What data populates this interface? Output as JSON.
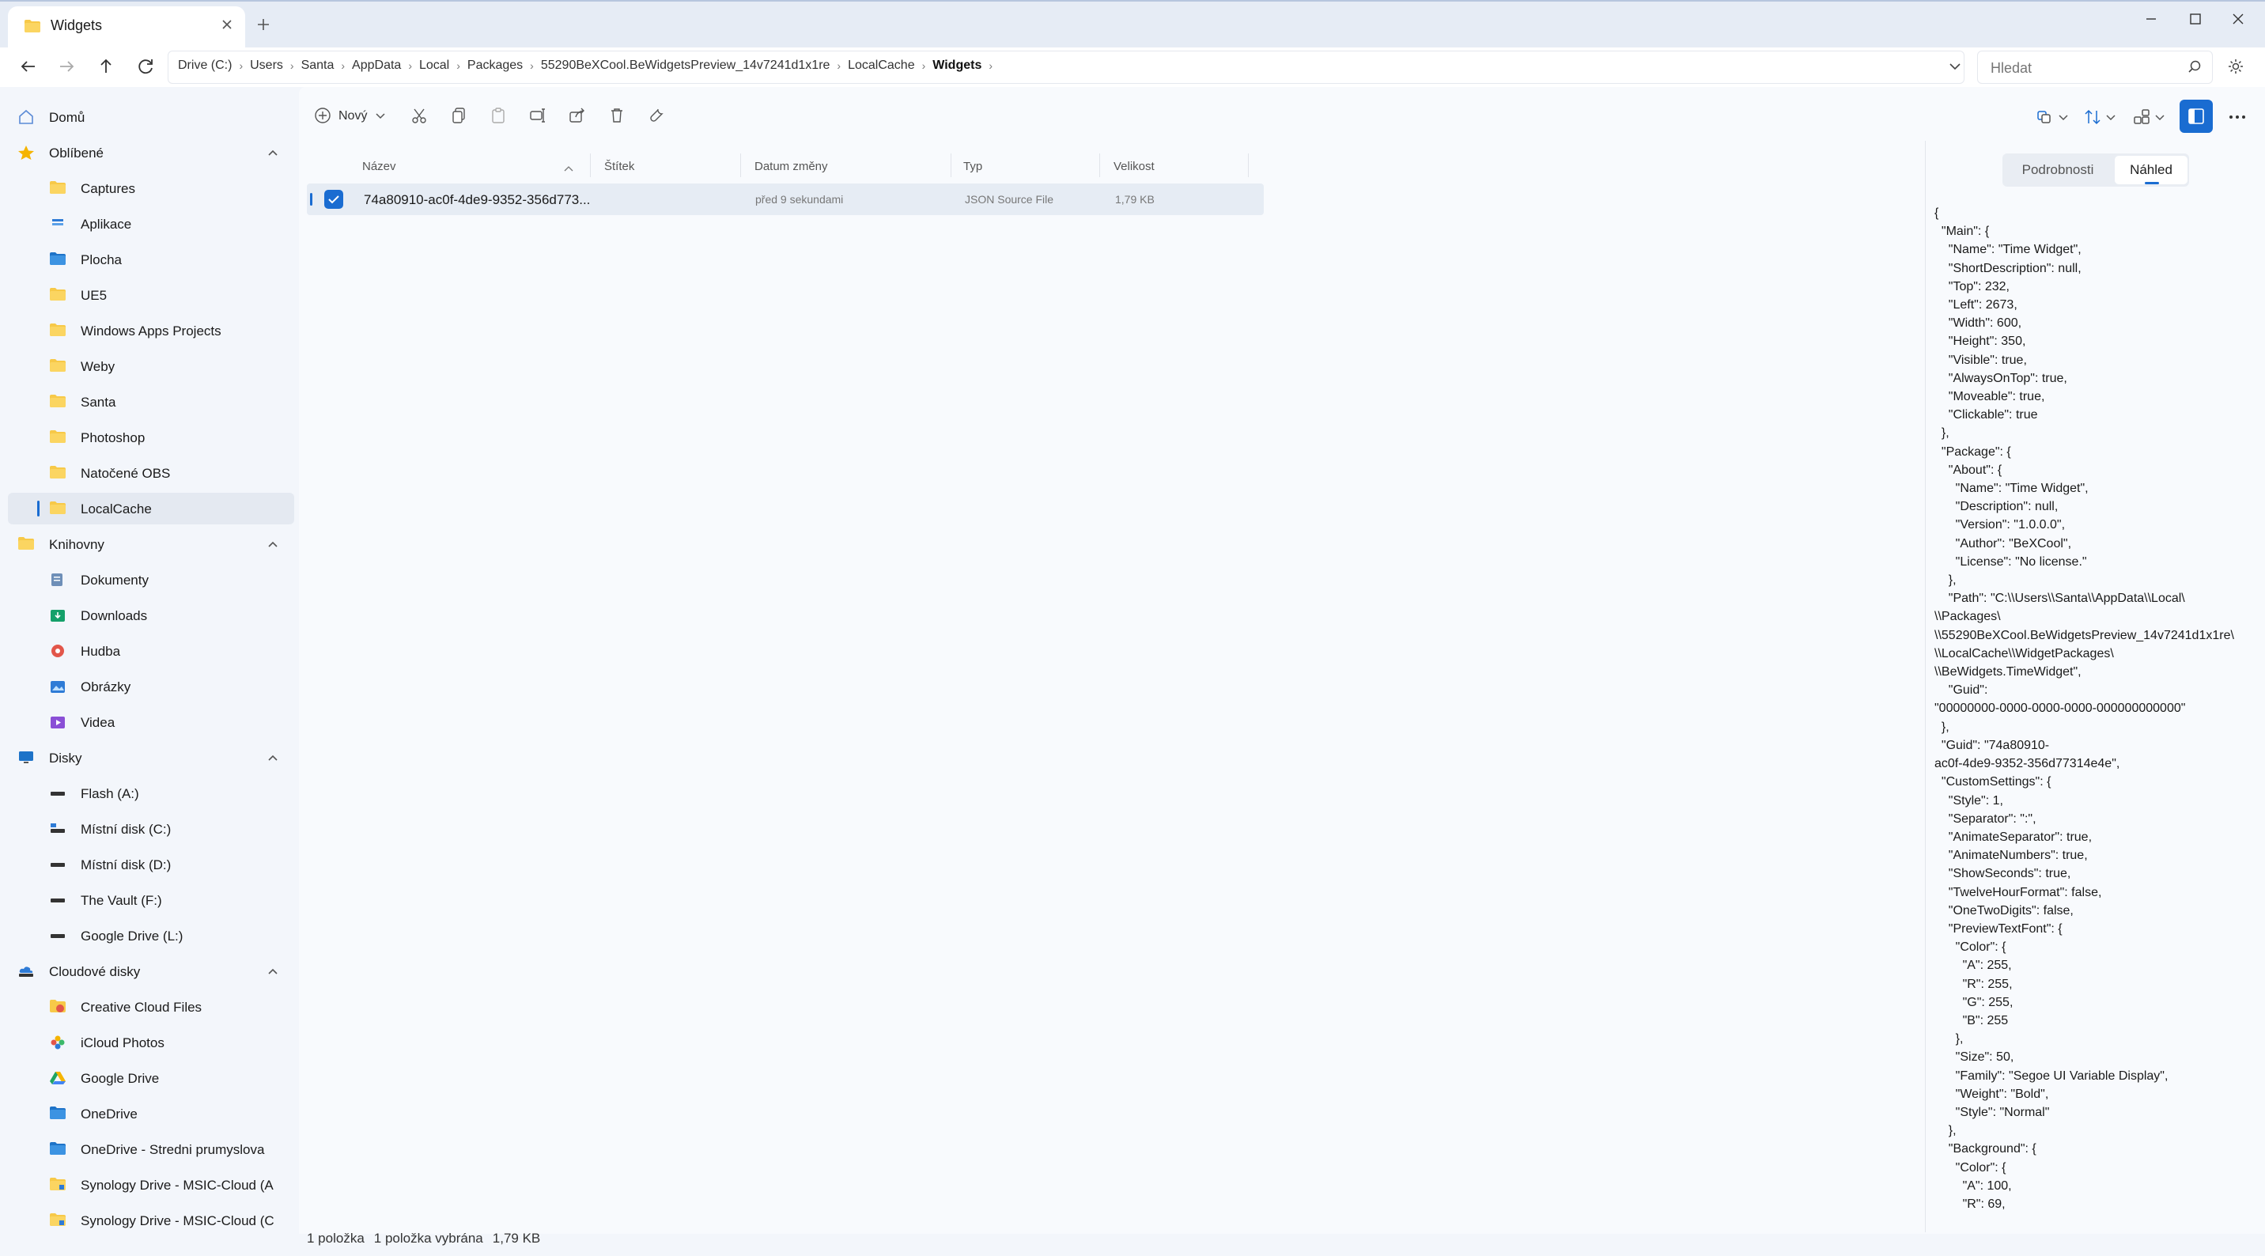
{
  "tab": {
    "title": "Widgets"
  },
  "breadcrumbs": [
    "Drive (C:)",
    "Users",
    "Santa",
    "AppData",
    "Local",
    "Packages",
    "55290BeXCool.BeWidgetsPreview_14v7241d1x1re",
    "LocalCache",
    "Widgets"
  ],
  "search": {
    "placeholder": "Hledat"
  },
  "sidebar": {
    "home": "Domů",
    "favorites": "Oblíbené",
    "favorite_items": [
      "Captures",
      "Aplikace",
      "Plocha",
      "UE5",
      "Windows Apps Projects",
      "Weby",
      "Santa",
      "Photoshop",
      "Natočené OBS",
      "LocalCache"
    ],
    "libraries": "Knihovny",
    "library_items": [
      "Dokumenty",
      "Downloads",
      "Hudba",
      "Obrázky",
      "Videa"
    ],
    "drives": "Disky",
    "drive_items": [
      "Flash (A:)",
      "Místní disk (C:)",
      "Místní disk (D:)",
      "The Vault (F:)",
      "Google Drive (L:)"
    ],
    "cloud": "Cloudové disky",
    "cloud_items": [
      "Creative Cloud Files",
      "iCloud Photos",
      "Google Drive",
      "OneDrive",
      "OneDrive - Stredni prumyslova",
      "Synology Drive - MSIC-Cloud (A",
      "Synology Drive - MSIC-Cloud (C"
    ]
  },
  "toolbar": {
    "new_label": "Nový"
  },
  "columns": {
    "name": "Název",
    "tag": "Štítek",
    "modified": "Datum změny",
    "type": "Typ",
    "size": "Velikost"
  },
  "file": {
    "name": "74a80910-ac0f-4de9-9352-356d773...",
    "modified": "před 9 sekundami",
    "type": "JSON Source File",
    "size": "1,79 KB"
  },
  "status": {
    "count": "1 položka",
    "selected": "1 položka vybrána",
    "size": "1,79 KB"
  },
  "preview": {
    "details_tab": "Podrobnosti",
    "preview_tab": "Náhled",
    "content": "{\n  \"Main\": {\n    \"Name\": \"Time Widget\",\n    \"ShortDescription\": null,\n    \"Top\": 232,\n    \"Left\": 2673,\n    \"Width\": 600,\n    \"Height\": 350,\n    \"Visible\": true,\n    \"AlwaysOnTop\": true,\n    \"Moveable\": true,\n    \"Clickable\": true\n  },\n  \"Package\": {\n    \"About\": {\n      \"Name\": \"Time Widget\",\n      \"Description\": null,\n      \"Version\": \"1.0.0.0\",\n      \"Author\": \"BeXCool\",\n      \"License\": \"No license.\"\n    },\n    \"Path\": \"C:\\\\Users\\\\Santa\\\\AppData\\\\Local\\\n\\\\Packages\\\n\\\\55290BeXCool.BeWidgetsPreview_14v7241d1x1re\\\n\\\\LocalCache\\\\WidgetPackages\\\n\\\\BeWidgets.TimeWidget\",\n    \"Guid\":\n\"00000000-0000-0000-0000-000000000000\"\n  },\n  \"Guid\": \"74a80910-\nac0f-4de9-9352-356d77314e4e\",\n  \"CustomSettings\": {\n    \"Style\": 1,\n    \"Separator\": \":\",\n    \"AnimateSeparator\": true,\n    \"AnimateNumbers\": true,\n    \"ShowSeconds\": true,\n    \"TwelveHourFormat\": false,\n    \"OneTwoDigits\": false,\n    \"PreviewTextFont\": {\n      \"Color\": {\n        \"A\": 255,\n        \"R\": 255,\n        \"G\": 255,\n        \"B\": 255\n      },\n      \"Size\": 50,\n      \"Family\": \"Segoe UI Variable Display\",\n      \"Weight\": \"Bold\",\n      \"Style\": \"Normal\"\n    },\n    \"Background\": {\n      \"Color\": {\n        \"A\": 100,\n        \"R\": 69,"
  },
  "colors": {
    "accent": "#1a6cd1",
    "folder": "#f7c948"
  }
}
